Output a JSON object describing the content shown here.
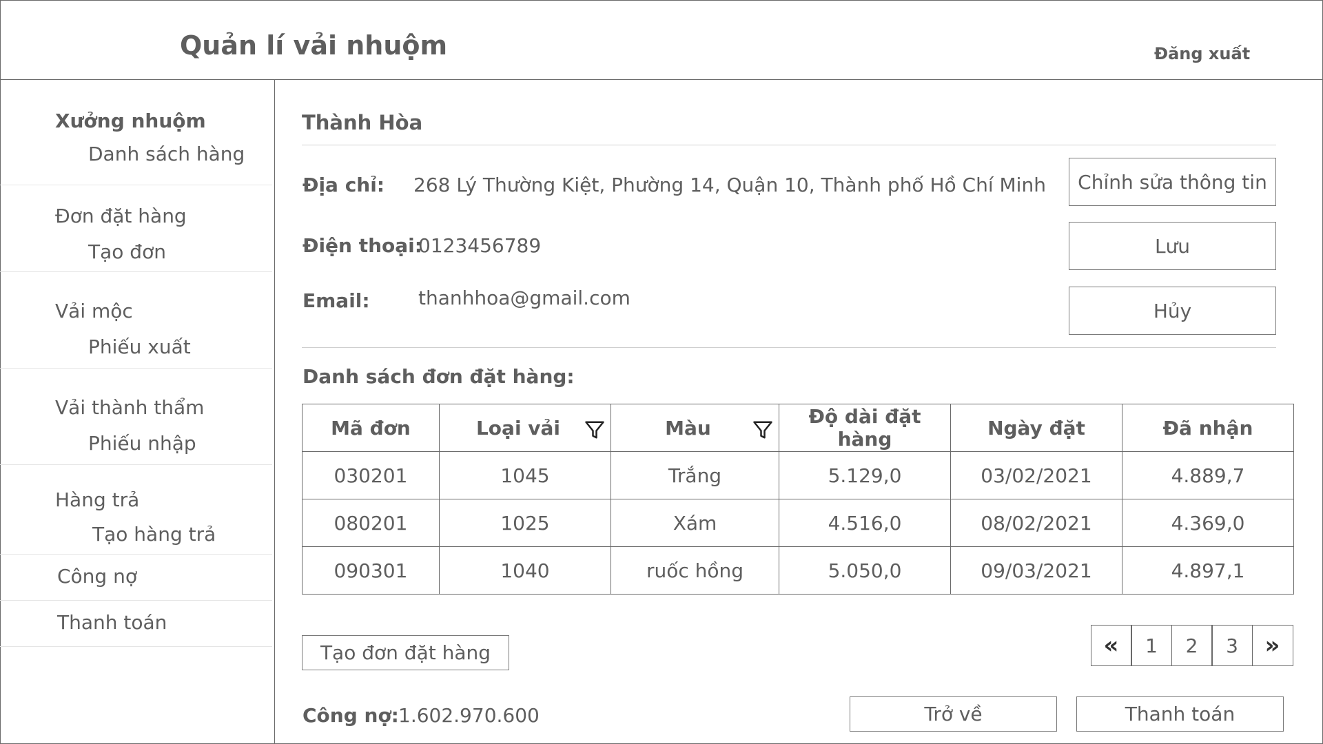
{
  "header": {
    "title": "Quản lí vải nhuộm",
    "logout": "Đăng xuất"
  },
  "sidebar": {
    "groups": [
      {
        "title": "Xưởng nhuộm",
        "sub": "Danh sách hàng"
      },
      {
        "title": "Đơn đặt hàng",
        "sub": "Tạo đơn"
      },
      {
        "title": "Vải mộc",
        "sub": "Phiếu xuất"
      },
      {
        "title": "Vải thành thẩm",
        "sub": "Phiếu nhập"
      },
      {
        "title": "Hàng trả",
        "sub": "Tạo hàng trả"
      },
      {
        "title": "Công nợ"
      },
      {
        "title": "Thanh toán"
      }
    ]
  },
  "customer": {
    "name": "Thành Hòa",
    "address_label": "Địa chỉ:",
    "address": "268 Lý Thường Kiệt, Phường 14, Quận 10, Thành phố Hồ Chí Minh",
    "phone_label": "Điện thoại:",
    "phone": "0123456789",
    "email_label": "Email:",
    "email": "thanhhoa@gmail.com"
  },
  "actions": {
    "edit": "Chỉnh sửa thông tin",
    "save": "Lưu",
    "cancel": "Hủy"
  },
  "orders": {
    "title": "Danh sách đơn đặt hàng:",
    "columns": [
      "Mã đơn",
      "Loại vải",
      "Màu",
      "Độ dài đặt hàng",
      "Ngày đặt",
      "Đã nhận"
    ],
    "rows": [
      [
        "030201",
        "1045",
        "Trắng",
        "5.129,0",
        "03/02/2021",
        "4.889,7"
      ],
      [
        "080201",
        "1025",
        "Xám",
        "4.516,0",
        "08/02/2021",
        "4.369,0"
      ],
      [
        "090301",
        "1040",
        "ruốc hồng",
        "5.050,0",
        "09/03/2021",
        "4.897,1"
      ]
    ]
  },
  "create_order": "Tạo đơn đặt hàng",
  "pagination": {
    "prev": "«",
    "pages": [
      "1",
      "2",
      "3"
    ],
    "next": "»"
  },
  "debt": {
    "label": "Công nợ:",
    "value": "1.602.970.600"
  },
  "footer": {
    "back": "Trở về",
    "pay": "Thanh toán"
  },
  "icons": {
    "filter": "filter-icon"
  }
}
